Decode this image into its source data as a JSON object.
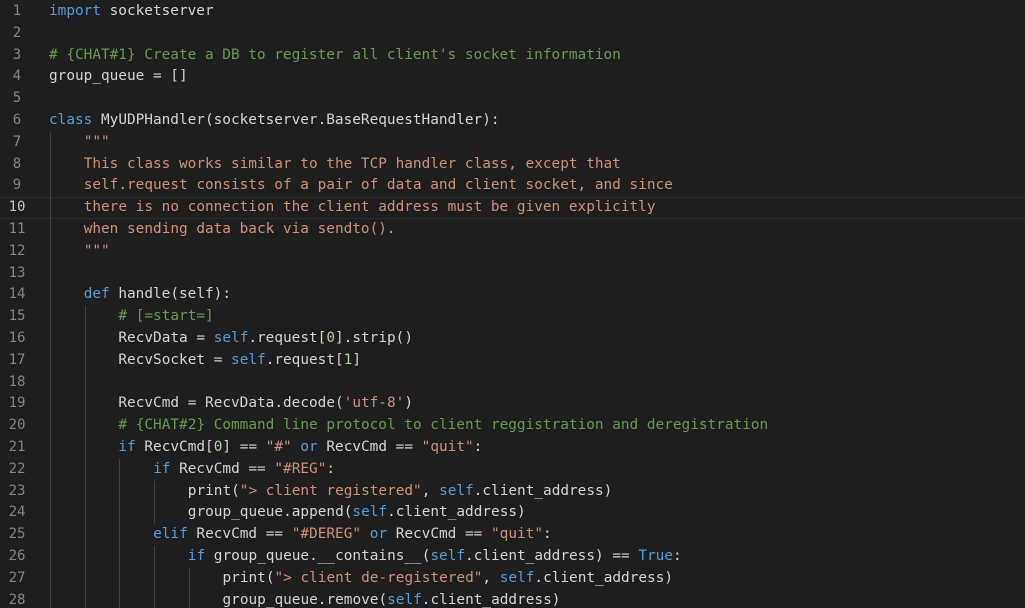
{
  "editor": {
    "language": "python",
    "colors": {
      "background": "#1e1e1e",
      "keyword": "#569cd6",
      "string": "#ce9178",
      "comment": "#6a9955",
      "number": "#b5cea8",
      "text": "#d4d4d4",
      "line_number": "#858585"
    },
    "current_line": 10,
    "lines": [
      {
        "n": "1",
        "indent": 0,
        "tokens": [
          {
            "t": "kw",
            "v": "import"
          },
          {
            "t": "plain",
            "v": " socketserver"
          }
        ]
      },
      {
        "n": "2",
        "indent": 0,
        "tokens": []
      },
      {
        "n": "3",
        "indent": 0,
        "tokens": [
          {
            "t": "com",
            "v": "# {CHAT#1} Create a DB to register all client's socket information"
          }
        ]
      },
      {
        "n": "4",
        "indent": 0,
        "tokens": [
          {
            "t": "plain",
            "v": "group_queue = []"
          }
        ]
      },
      {
        "n": "5",
        "indent": 0,
        "tokens": []
      },
      {
        "n": "6",
        "indent": 0,
        "tokens": [
          {
            "t": "kw",
            "v": "class"
          },
          {
            "t": "plain",
            "v": " MyUDPHandler(socketserver.BaseRequestHandler):"
          }
        ]
      },
      {
        "n": "7",
        "indent": 1,
        "tokens": [
          {
            "t": "str",
            "v": "\"\"\""
          }
        ]
      },
      {
        "n": "8",
        "indent": 1,
        "tokens": [
          {
            "t": "str",
            "v": "This class works similar to the TCP handler class, except that"
          }
        ]
      },
      {
        "n": "9",
        "indent": 1,
        "tokens": [
          {
            "t": "str",
            "v": "self.request consists of a pair of data and client socket, and since"
          }
        ]
      },
      {
        "n": "10",
        "indent": 1,
        "tokens": [
          {
            "t": "str",
            "v": "there is no connection the client address must be given explicitly"
          }
        ]
      },
      {
        "n": "11",
        "indent": 1,
        "tokens": [
          {
            "t": "str",
            "v": "when sending data back via sendto()."
          }
        ]
      },
      {
        "n": "12",
        "indent": 1,
        "tokens": [
          {
            "t": "str",
            "v": "\"\"\""
          }
        ]
      },
      {
        "n": "13",
        "indent": 1,
        "tokens": []
      },
      {
        "n": "14",
        "indent": 1,
        "tokens": [
          {
            "t": "kw",
            "v": "def"
          },
          {
            "t": "plain",
            "v": " handle(self):"
          }
        ]
      },
      {
        "n": "15",
        "indent": 2,
        "tokens": [
          {
            "t": "com",
            "v": "# [=start=]"
          }
        ]
      },
      {
        "n": "16",
        "indent": 2,
        "tokens": [
          {
            "t": "plain",
            "v": "RecvData = "
          },
          {
            "t": "kw",
            "v": "self"
          },
          {
            "t": "plain",
            "v": ".request["
          },
          {
            "t": "num",
            "v": "0"
          },
          {
            "t": "plain",
            "v": "].strip()"
          }
        ]
      },
      {
        "n": "17",
        "indent": 2,
        "tokens": [
          {
            "t": "plain",
            "v": "RecvSocket = "
          },
          {
            "t": "kw",
            "v": "self"
          },
          {
            "t": "plain",
            "v": ".request["
          },
          {
            "t": "num",
            "v": "1"
          },
          {
            "t": "plain",
            "v": "]"
          }
        ]
      },
      {
        "n": "18",
        "indent": 2,
        "tokens": []
      },
      {
        "n": "19",
        "indent": 2,
        "tokens": [
          {
            "t": "plain",
            "v": "RecvCmd = RecvData.decode("
          },
          {
            "t": "str",
            "v": "'utf-8'"
          },
          {
            "t": "plain",
            "v": ")"
          }
        ]
      },
      {
        "n": "20",
        "indent": 2,
        "tokens": [
          {
            "t": "com",
            "v": "# {CHAT#2} Command line protocol to client reggistration and deregistration"
          }
        ]
      },
      {
        "n": "21",
        "indent": 2,
        "tokens": [
          {
            "t": "kw",
            "v": "if"
          },
          {
            "t": "plain",
            "v": " RecvCmd["
          },
          {
            "t": "num",
            "v": "0"
          },
          {
            "t": "plain",
            "v": "] == "
          },
          {
            "t": "str",
            "v": "\"#\""
          },
          {
            "t": "plain",
            "v": " "
          },
          {
            "t": "kw",
            "v": "or"
          },
          {
            "t": "plain",
            "v": " RecvCmd == "
          },
          {
            "t": "str",
            "v": "\"quit\""
          },
          {
            "t": "plain",
            "v": ":"
          }
        ]
      },
      {
        "n": "22",
        "indent": 3,
        "tokens": [
          {
            "t": "kw",
            "v": "if"
          },
          {
            "t": "plain",
            "v": " RecvCmd == "
          },
          {
            "t": "str",
            "v": "\"#REG\""
          },
          {
            "t": "plain",
            "v": ":"
          }
        ]
      },
      {
        "n": "23",
        "indent": 4,
        "tokens": [
          {
            "t": "plain",
            "v": "print("
          },
          {
            "t": "str",
            "v": "\"> client registered\""
          },
          {
            "t": "plain",
            "v": ", "
          },
          {
            "t": "kw",
            "v": "self"
          },
          {
            "t": "plain",
            "v": ".client_address)"
          }
        ]
      },
      {
        "n": "24",
        "indent": 4,
        "tokens": [
          {
            "t": "plain",
            "v": "group_queue.append("
          },
          {
            "t": "kw",
            "v": "self"
          },
          {
            "t": "plain",
            "v": ".client_address)"
          }
        ]
      },
      {
        "n": "25",
        "indent": 3,
        "tokens": [
          {
            "t": "kw",
            "v": "elif"
          },
          {
            "t": "plain",
            "v": " RecvCmd == "
          },
          {
            "t": "str",
            "v": "\"#DEREG\""
          },
          {
            "t": "plain",
            "v": " "
          },
          {
            "t": "kw",
            "v": "or"
          },
          {
            "t": "plain",
            "v": " RecvCmd == "
          },
          {
            "t": "str",
            "v": "\"quit\""
          },
          {
            "t": "plain",
            "v": ":"
          }
        ]
      },
      {
        "n": "26",
        "indent": 4,
        "tokens": [
          {
            "t": "kw",
            "v": "if"
          },
          {
            "t": "plain",
            "v": " group_queue.__contains__("
          },
          {
            "t": "kw",
            "v": "self"
          },
          {
            "t": "plain",
            "v": ".client_address) == "
          },
          {
            "t": "kw",
            "v": "True"
          },
          {
            "t": "plain",
            "v": ":"
          }
        ]
      },
      {
        "n": "27",
        "indent": 5,
        "tokens": [
          {
            "t": "plain",
            "v": "print("
          },
          {
            "t": "str",
            "v": "\"> client de-registered\""
          },
          {
            "t": "plain",
            "v": ", "
          },
          {
            "t": "kw",
            "v": "self"
          },
          {
            "t": "plain",
            "v": ".client_address)"
          }
        ]
      },
      {
        "n": "28",
        "indent": 5,
        "tokens": [
          {
            "t": "plain",
            "v": "group_queue.remove("
          },
          {
            "t": "kw",
            "v": "self"
          },
          {
            "t": "plain",
            "v": ".client_address)"
          }
        ]
      }
    ]
  }
}
